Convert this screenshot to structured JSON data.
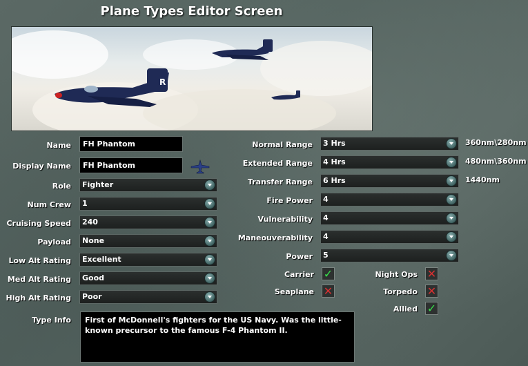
{
  "window": {
    "title": "Plane Types Editor Screen"
  },
  "form": {
    "name": {
      "label": "Name",
      "value": "FH Phantom"
    },
    "display_name": {
      "label": "Display Name",
      "value": "FH Phantom"
    },
    "role": {
      "label": "Role",
      "value": "Fighter"
    },
    "num_crew": {
      "label": "Num Crew",
      "value": "1"
    },
    "cruising_speed": {
      "label": "Cruising Speed",
      "value": "240"
    },
    "payload": {
      "label": "Payload",
      "value": "None"
    },
    "low_alt_rating": {
      "label": "Low Alt Rating",
      "value": "Excellent"
    },
    "med_alt_rating": {
      "label": "Med Alt Rating",
      "value": "Good"
    },
    "high_alt_rating": {
      "label": "High Alt Rating",
      "value": "Poor"
    },
    "type_info": {
      "label": "Type Info",
      "value": "First of McDonnell's fighters for the US Navy. Was the little-known precursor to the famous F-4 Phantom II."
    },
    "normal_range": {
      "label": "Normal Range",
      "value": "3 Hrs",
      "side": "360nm\\280nm"
    },
    "extended_range": {
      "label": "Extended Range",
      "value": "4 Hrs",
      "side": "480nm\\360nm"
    },
    "transfer_range": {
      "label": "Transfer Range",
      "value": "6 Hrs",
      "side": "1440nm"
    },
    "fire_power": {
      "label": "Fire Power",
      "value": "4"
    },
    "vulnerability": {
      "label": "Vulnerability",
      "value": "4"
    },
    "maneuverability": {
      "label": "Maneouverability",
      "value": "4"
    },
    "power": {
      "label": "Power",
      "value": "5"
    }
  },
  "flags": {
    "carrier": {
      "label": "Carrier",
      "checked": true
    },
    "seaplane": {
      "label": "Seaplane",
      "checked": false
    },
    "night_ops": {
      "label": "Night Ops",
      "checked": false
    },
    "torpedo": {
      "label": "Torpedo",
      "checked": false
    },
    "allied": {
      "label": "Allied",
      "checked": true
    }
  },
  "glyphs": {
    "check": "✓",
    "cross": "✕"
  },
  "colors": {
    "checked": "#39e04b",
    "unchecked": "#d63131",
    "dropdown_arrow": "#3f6261"
  }
}
